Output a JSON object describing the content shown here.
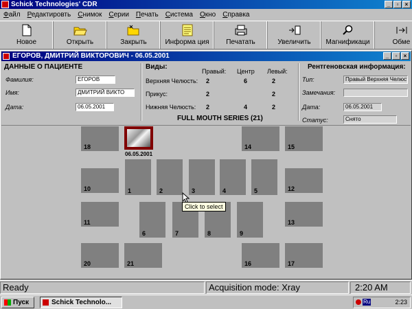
{
  "app": {
    "title": "Schick Technologies' CDR"
  },
  "menu": [
    "Файл",
    "Редактировть",
    "Снимок",
    "Серии",
    "Печать",
    "Система",
    "Окно",
    "Справка"
  ],
  "toolbar": [
    {
      "label": "Новое",
      "icon": "new-document-icon"
    },
    {
      "label": "Открыть",
      "icon": "open-folder-icon"
    },
    {
      "label": "Закрыть",
      "icon": "close-folder-icon"
    },
    {
      "label": "Информа ция",
      "icon": "info-notes-icon"
    },
    {
      "label": "Печатать",
      "icon": "printer-icon"
    },
    {
      "label": "Увеличить",
      "icon": "enlarge-icon"
    },
    {
      "label": "Магнификаци",
      "icon": "magnify-icon"
    },
    {
      "label": "Обме",
      "icon": "exchange-icon"
    }
  ],
  "patient_window": {
    "title": "ЕГОРОВ, ДМИТРИЙ  ВИКТОРОВИЧ - 06.05.2001"
  },
  "patient": {
    "heading": "ДАННЫЕ О ПАЦИЕНТЕ",
    "surname_label": "Фамилия:",
    "surname": "ЕГОРОВ",
    "name_label": "Имя:",
    "name": "ДМИТРИЙ  ВИКТО",
    "date_label": "Дата:",
    "date": "06.05.2001"
  },
  "views": {
    "heading": "Виды:",
    "cols": [
      "Правый:",
      "Центр",
      "Левый:"
    ],
    "rows": [
      {
        "label": "Верхняя Челюсть:",
        "values": [
          "2",
          "6",
          "2"
        ]
      },
      {
        "label": "Прикус:",
        "values": [
          "2",
          "",
          "2"
        ]
      },
      {
        "label": "Нижняя Челюсть:",
        "values": [
          "2",
          "4",
          "2"
        ]
      }
    ],
    "series": "FULL MOUTH SERIES (21)"
  },
  "xray_info": {
    "heading": "Рентгеновская информация:",
    "type_label": "Тип:",
    "type": "Правый Верхняя Челюсть",
    "notes_label": "Замечания:",
    "notes": "",
    "date_label": "Дата:",
    "date": "06.05.2001",
    "status_label": "Статус:",
    "status": "Снято"
  },
  "slots": [
    "18",
    "",
    "14",
    "15",
    "1",
    "2",
    "3",
    "4",
    "5",
    "10",
    "12",
    "11",
    "6",
    "7",
    "8",
    "9",
    "13",
    "20",
    "21",
    "16",
    "17"
  ],
  "captured": {
    "date": "06.05.2001"
  },
  "tooltip": "Click to select",
  "status": {
    "ready": "Ready",
    "mode": "Acquisition mode: Xray",
    "time": "2:20 AM"
  },
  "taskbar": {
    "start": "Пуск",
    "task": "Schick Technolo...",
    "lang": "Ru",
    "clock": "2:23"
  }
}
